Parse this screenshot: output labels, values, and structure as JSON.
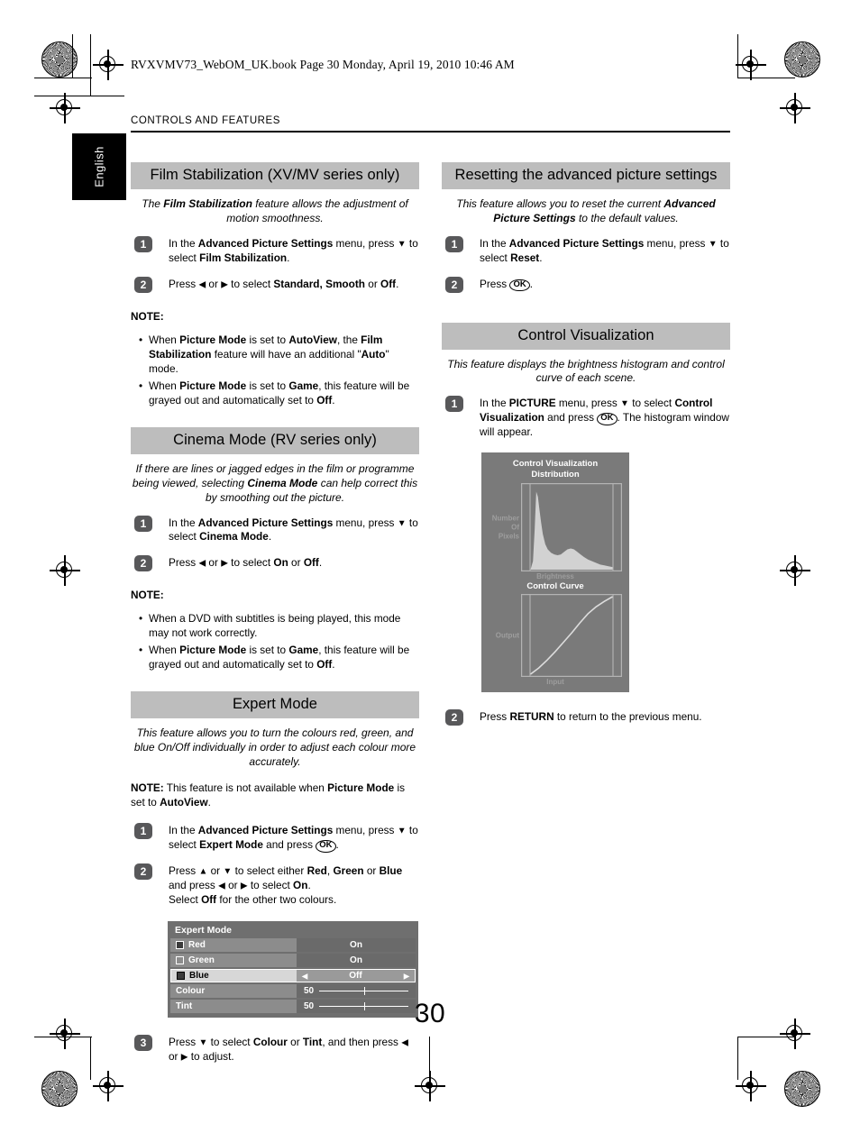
{
  "header": {
    "file_line": "RVXVMV73_WebOM_UK.book  Page 30  Monday, April 19, 2010  10:46 AM",
    "running_head": "CONTROLS AND FEATURES",
    "language_tab": "English"
  },
  "folio": "30",
  "left_column": {
    "sections": [
      {
        "id": "film-stabilization",
        "title": "Film Stabilization (XV/MV series only)",
        "intro_prefix": "The ",
        "intro_bold": "Film Stabilization",
        "intro_suffix": " feature allows the adjustment of motion smoothness.",
        "steps": [
          {
            "num": "1",
            "text": "In the Advanced Picture Settings menu, press ▼ to select Film Stabilization."
          },
          {
            "num": "2",
            "text": "Press ◀ or ▶ to select Standard, Smooth or Off."
          }
        ],
        "note_label": "NOTE:",
        "bullets": [
          "When Picture Mode is set to AutoView, the Film Stabilization feature will have an additional \"Auto\" mode.",
          "When Picture Mode is set to Game, this feature will be grayed out and automatically set to Off."
        ]
      },
      {
        "id": "cinema-mode",
        "title": "Cinema Mode (RV series only)",
        "intro": "If there are lines or jagged edges in the film or programme being viewed, selecting Cinema Mode can help correct this by smoothing out the picture.",
        "steps": [
          {
            "num": "1",
            "text": "In the Advanced Picture Settings menu, press ▼ to select Cinema Mode."
          },
          {
            "num": "2",
            "text": "Press ◀ or ▶ to select On or Off."
          }
        ],
        "note_label": "NOTE:",
        "bullets": [
          "When a DVD with subtitles is being played, this mode may not work correctly.",
          "When Picture Mode is set to Game, this feature will be grayed out and automatically set to Off."
        ]
      },
      {
        "id": "expert-mode",
        "title": "Expert Mode",
        "intro": "This feature allows you to turn the colours red, green, and blue On/Off individually in order to adjust each colour more accurately.",
        "note_label": "NOTE:",
        "note_text": "This feature is not available when Picture Mode is set to AutoView.",
        "steps": [
          {
            "num": "1",
            "text": "In the Advanced Picture Settings menu, press ▼ to select Expert Mode and press OK."
          },
          {
            "num": "2",
            "text": "Press ▲ or ▼ to select either Red, Green or Blue and press ◀ or ▶ to select On. Select Off for the other two colours."
          },
          {
            "num": "3",
            "text": "Press ▼ to select Colour or Tint, and then press ◀ or ▶ to adjust."
          }
        ]
      }
    ]
  },
  "right_column": {
    "sections": [
      {
        "id": "reset-advanced",
        "title": "Resetting the advanced picture settings",
        "intro": "This feature allows you to reset the current Advanced Picture Settings to the default values.",
        "steps": [
          {
            "num": "1",
            "text": "In the Advanced Picture Settings menu, press ▼ to select Reset."
          },
          {
            "num": "2",
            "text": "Press OK."
          }
        ]
      },
      {
        "id": "control-visualization",
        "title": "Control Visualization",
        "intro": "This feature displays the brightness histogram and control curve of each scene.",
        "steps": [
          {
            "num": "1",
            "text": "In the PICTURE menu, press ▼ to select Control Visualization and press OK. The histogram window will appear."
          },
          {
            "num": "2",
            "text": "Press RETURN to return to the previous menu."
          }
        ]
      }
    ]
  },
  "expert_mode_osd": {
    "title": "Expert Mode",
    "rows": [
      {
        "label": "Red",
        "value": "On",
        "swatch": "filled",
        "selected": false,
        "type": "toggle"
      },
      {
        "label": "Green",
        "value": "On",
        "swatch": "empty",
        "selected": false,
        "type": "toggle"
      },
      {
        "label": "Blue",
        "value": "Off",
        "swatch": "filled",
        "selected": true,
        "type": "toggle"
      },
      {
        "label": "Colour",
        "value": "50",
        "selected": false,
        "type": "slider"
      },
      {
        "label": "Tint",
        "value": "50",
        "selected": false,
        "type": "slider"
      }
    ],
    "caret_left": "◀",
    "caret_right": "▶",
    "colors": {
      "panel_bg": "#6f6f6f",
      "label_bg": "#8c8c8c",
      "value_bg": "#6a6a6a",
      "selected_label_bg": "#d7d7d7",
      "selected_value_bg": "#9a9a9a"
    }
  },
  "control_visualization_osd": {
    "title_line1": "Control Visualization",
    "title_line2": "Distribution",
    "histogram_ylabel": "Number\nOf\nPixels",
    "histogram_ylabel_lines": [
      "Number",
      "Of",
      "Pixels"
    ],
    "histogram_xlabel": "Brightness",
    "curve_title": "Control Curve",
    "curve_ylabel": "Output",
    "curve_xlabel": "Input",
    "colors": {
      "panel_bg": "#7a7a7a",
      "frame": "#b4b4b4",
      "fill": "#d2d2d2",
      "axis_label": "#9e9e9e"
    }
  },
  "chart_data": [
    {
      "type": "area",
      "id": "brightness-distribution",
      "title": "Control Visualization Distribution",
      "xlabel": "Brightness",
      "ylabel": "Number Of Pixels",
      "xlim": [
        0,
        100
      ],
      "ylim": [
        0,
        100
      ],
      "grid": false,
      "x": [
        0,
        3,
        5,
        7,
        9,
        11,
        13,
        15,
        18,
        21,
        25,
        29,
        33,
        37,
        41,
        45,
        49,
        53,
        57,
        61,
        65,
        70,
        75,
        80,
        85,
        90,
        95,
        100
      ],
      "values": [
        0,
        10,
        46,
        92,
        86,
        70,
        55,
        42,
        30,
        24,
        20,
        18,
        17,
        18,
        21,
        24,
        25,
        24,
        21,
        18,
        15,
        12,
        10,
        8,
        6,
        5,
        4,
        3
      ]
    },
    {
      "type": "line",
      "id": "control-curve",
      "title": "Control Curve",
      "xlabel": "Input",
      "ylabel": "Output",
      "xlim": [
        0,
        100
      ],
      "ylim": [
        0,
        100
      ],
      "grid": false,
      "x": [
        0,
        10,
        20,
        30,
        40,
        50,
        60,
        70,
        80,
        90,
        100
      ],
      "values": [
        0,
        8,
        18,
        29,
        41,
        53,
        66,
        78,
        87,
        94,
        100
      ]
    }
  ]
}
